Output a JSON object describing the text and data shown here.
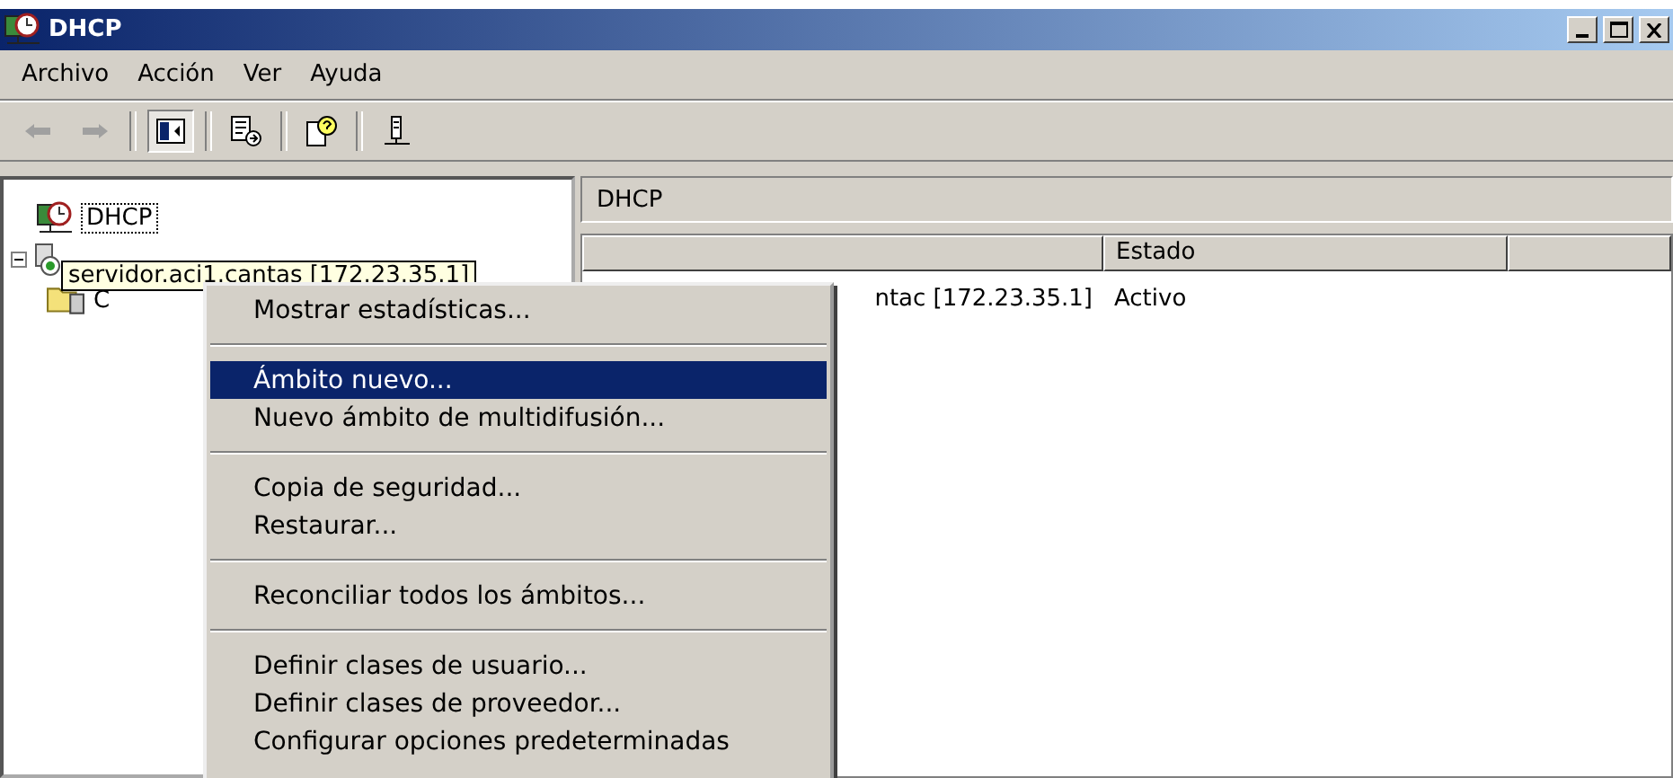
{
  "window": {
    "title": "DHCP"
  },
  "menu_bar": [
    "Archivo",
    "Acción",
    "Ver",
    "Ayuda"
  ],
  "toolbar": [
    {
      "kind": "back",
      "disabled": true
    },
    {
      "kind": "forward",
      "disabled": true
    },
    {
      "kind": "separator"
    },
    {
      "kind": "tree",
      "pressed": true
    },
    {
      "kind": "separator"
    },
    {
      "kind": "export",
      "pressed": false
    },
    {
      "kind": "separator"
    },
    {
      "kind": "help",
      "pressed": false
    },
    {
      "kind": "separator"
    },
    {
      "kind": "server",
      "pressed": false
    }
  ],
  "tree": [
    {
      "kind": "root",
      "label": "DHCP",
      "children": [
        {
          "kind": "server",
          "expanded": true,
          "children": [
            {
              "kind": "folder",
              "label": "C"
            }
          ]
        }
      ]
    }
  ],
  "tooltip": {
    "text": "servidor.aci1.cantas [172.23.35.1]"
  },
  "details": {
    "title": "DHCP",
    "columns": [
      "Estado"
    ],
    "rows": [
      {
        "column_1": "ntac [172.23.35.1]",
        "estado": "Activo"
      }
    ]
  },
  "context_menu": [
    {
      "kind": "item",
      "label": "Mostrar estadísticas...",
      "selected": false
    },
    {
      "kind": "separator"
    },
    {
      "kind": "item",
      "label": "Ámbito nuevo...",
      "selected": true
    },
    {
      "kind": "item",
      "label": "Nuevo ámbito de multidifusión...",
      "selected": false
    },
    {
      "kind": "separator"
    },
    {
      "kind": "item",
      "label": "Copia de seguridad...",
      "selected": false
    },
    {
      "kind": "item",
      "label": "Restaurar...",
      "selected": false
    },
    {
      "kind": "separator"
    },
    {
      "kind": "item",
      "label": "Reconciliar todos los ámbitos...",
      "selected": false
    },
    {
      "kind": "separator"
    },
    {
      "kind": "item",
      "label": "Definir clases de usuario...",
      "selected": false
    },
    {
      "kind": "item",
      "label": "Definir clases de proveedor...",
      "selected": false
    },
    {
      "kind": "item",
      "label": "Configurar opciones predeterminadas",
      "selected": false
    }
  ]
}
